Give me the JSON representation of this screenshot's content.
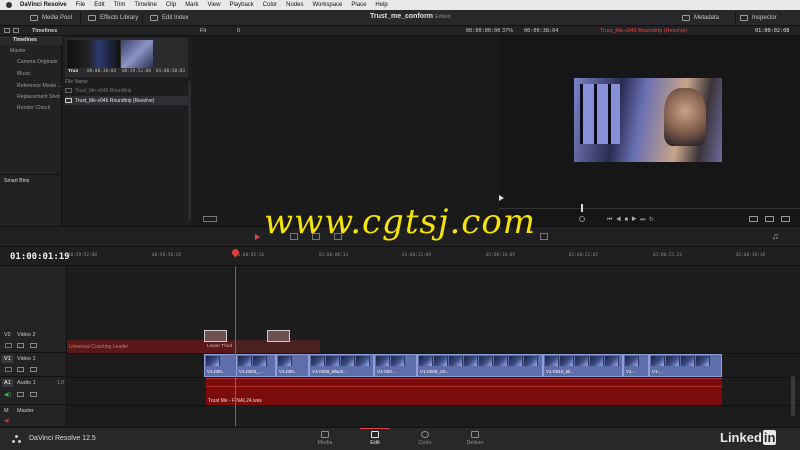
{
  "menubar": {
    "app": "DaVinci Resolve",
    "items": [
      "File",
      "Edit",
      "Trim",
      "Timeline",
      "Clip",
      "Mark",
      "View",
      "Playback",
      "Color",
      "Nodes",
      "Workspace",
      "Place",
      "Help"
    ]
  },
  "toolbar": {
    "media_pool": "Media Pool",
    "effects_library": "Effects Library",
    "edit_index": "Edit Index",
    "project_title": "Trust_me_conform",
    "project_state": "Edited",
    "metadata": "Metadata",
    "inspector": "Inspector"
  },
  "subbar": {
    "timelines": "Timelines",
    "fit": "Fit",
    "zero": "0",
    "source_tc": "00:00:00:00",
    "zoom": "37%",
    "duration_tc": "00:00:38:04",
    "timeline_name": "Trust_Me-v045 Roundtrip (Resolve)",
    "record_tc": "01:00:02:08"
  },
  "bins": {
    "header": "Timelines",
    "items": [
      "Master",
      "Camera Originals ...",
      "Music",
      "Reference Movie ...",
      "Replacement Shot",
      "Render Check"
    ],
    "smart_bins": "Smart Bins"
  },
  "media": {
    "thumb_label": "Trus",
    "thumb_tc1": "00:00:38:04",
    "thumb_tc2": "00:59:52:00",
    "thumb_tc3": "01:00:50:03",
    "column_header": "File Name",
    "rows": [
      "Trust_Me-v045 Roundtrip",
      "Trust_Me-v045 Roundtrip (Resolve)"
    ]
  },
  "watermark": "www.cgtsj.com",
  "timeline": {
    "current_tc": "01:00:01:19",
    "ruler": [
      "00:59:52:00",
      "00:59:56:20",
      "01:00:01:16",
      "01:00:06:13",
      "01:00:11:09",
      "01:00:16:05",
      "01:00:21:02",
      "01:00:25:22",
      "01:00:30:18"
    ],
    "tracks": {
      "v2": {
        "id": "V2",
        "name": "Video 2"
      },
      "v1": {
        "id": "V1",
        "name": "Video 1"
      },
      "a1": {
        "id": "A1",
        "name": "Audio 1",
        "channel": "1.0"
      },
      "master": {
        "id": "M",
        "name": "Master"
      }
    },
    "clips": {
      "leader": "Universal Counting Leader",
      "lower_third": "Lower Third",
      "v1_clips": [
        "V1-000...",
        "V1-0002_...",
        "V1-000...",
        "V1-0006_Black...",
        "V1-000...",
        "V1-0009_A0...",
        "V1-0010_Bl...",
        "V1-...",
        "V1-..."
      ],
      "audio": "Trust Me - FINAL24.wav"
    }
  },
  "pagebar": {
    "product": "DaVinci Resolve 12.5",
    "pages": [
      "Media",
      "Edit",
      "Color",
      "Deliver"
    ],
    "active_page": "Edit",
    "brand": "Linked",
    "brand_in": "in"
  },
  "colors": {
    "leader_red": "#5a1818",
    "audio_red": "#7a0c0c",
    "clip_blue": "#5d6eaa",
    "playhead": "#e23b3b",
    "watermark": "#f4e30c"
  }
}
